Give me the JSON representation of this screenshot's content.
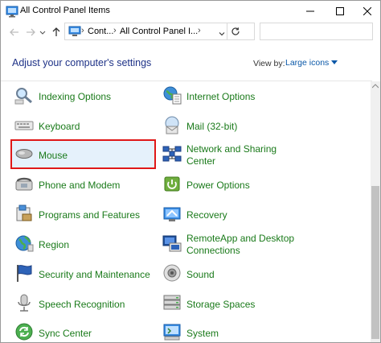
{
  "window": {
    "title": "All Control Panel Items",
    "controls": {
      "minimize": "minimize",
      "maximize": "maximize",
      "close": "close"
    }
  },
  "address": {
    "segments": [
      "Cont...",
      "All Control Panel I..."
    ],
    "search_placeholder": ""
  },
  "header": {
    "heading": "Adjust your computer's settings",
    "view_by_label": "View by:",
    "view_by_value": "Large icons"
  },
  "items_left": [
    {
      "label": "Indexing Options",
      "icon": "indexing-icon"
    },
    {
      "label": "Keyboard",
      "icon": "keyboard-icon"
    },
    {
      "label": "Mouse",
      "icon": "mouse-icon"
    },
    {
      "label": "Phone and Modem",
      "icon": "phone-modem-icon"
    },
    {
      "label": "Programs and Features",
      "icon": "programs-icon"
    },
    {
      "label": "Region",
      "icon": "region-icon"
    },
    {
      "label": "Security and Maintenance",
      "icon": "security-flag-icon"
    },
    {
      "label": "Speech Recognition",
      "icon": "microphone-icon"
    },
    {
      "label": "Sync Center",
      "icon": "sync-icon"
    }
  ],
  "items_right": [
    {
      "label": "Internet Options",
      "icon": "internet-options-icon"
    },
    {
      "label": "Mail (32-bit)",
      "icon": "mail-icon"
    },
    {
      "label": "Network and Sharing",
      "label2": "Center",
      "icon": "network-icon"
    },
    {
      "label": "Power Options",
      "icon": "power-icon"
    },
    {
      "label": "Recovery",
      "icon": "recovery-icon"
    },
    {
      "label": "RemoteApp and Desktop",
      "label2": "Connections",
      "icon": "remoteapp-icon"
    },
    {
      "label": "Sound",
      "icon": "speaker-icon"
    },
    {
      "label": "Storage Spaces",
      "icon": "storage-icon"
    },
    {
      "label": "System",
      "icon": "system-icon"
    }
  ],
  "highlighted_item": "Mouse",
  "colors": {
    "link_green": "#1a7a1a",
    "heading_blue": "#1e3287",
    "highlight_border": "#e01818",
    "highlight_bg": "#e5f1fb"
  }
}
